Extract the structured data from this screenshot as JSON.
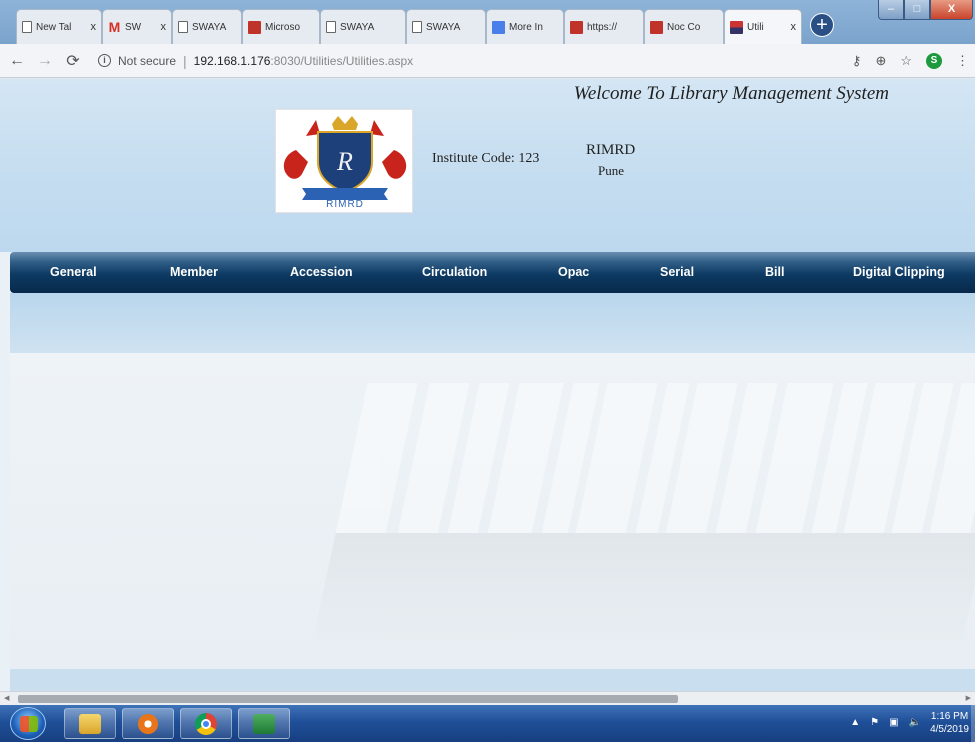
{
  "browser": {
    "tabs": [
      {
        "title": "New Tal",
        "favicon": "page-icon",
        "closable": true
      },
      {
        "title": "SW",
        "favicon": "gmail-icon",
        "closable": true
      },
      {
        "title": "SWAYA",
        "favicon": "document-icon",
        "closable": false
      },
      {
        "title": "Microso",
        "favicon": "app-red-icon",
        "closable": false
      },
      {
        "title": "SWAYA",
        "favicon": "document-icon",
        "closable": false
      },
      {
        "title": "SWAYA",
        "favicon": "document-icon",
        "closable": false
      },
      {
        "title": "More In",
        "favicon": "forms-icon",
        "closable": false
      },
      {
        "title": "https://",
        "favicon": "app-red-icon",
        "closable": false
      },
      {
        "title": "Noc Co",
        "favicon": "app-red-icon",
        "closable": false
      },
      {
        "title": "Utili",
        "favicon": "flag-icon",
        "closable": true
      }
    ],
    "new_tab_label": "+",
    "close_glyph": "x",
    "window_controls": {
      "minimize": "–",
      "maximize": "□",
      "close": "X"
    },
    "address": {
      "security_label": "Not secure",
      "url_host": "192.168.1.176",
      "url_path": ":8030/Utilities/Utilities.aspx"
    },
    "profile_initial": "S"
  },
  "header": {
    "welcome": "Welcome To Library Management System",
    "logo_caption": "RIMRD",
    "logo_monogram": "R",
    "institute_code_label": "Institute Code: 123",
    "institute_name": "RIMRD",
    "institute_city": "Pune"
  },
  "menu": [
    {
      "label": "General"
    },
    {
      "label": "Member"
    },
    {
      "label": "Accession"
    },
    {
      "label": "Circulation"
    },
    {
      "label": "Opac"
    },
    {
      "label": "Serial"
    },
    {
      "label": "Bill"
    },
    {
      "label": "Digital Clipping"
    }
  ],
  "taskbar": {
    "apps": [
      "folder-icon",
      "media-player-icon",
      "chrome-icon",
      "excel-icon"
    ],
    "clock_time": "1:16 PM",
    "clock_date": "4/5/2019"
  },
  "colors": {
    "menu_bar": "#0d3a63",
    "header_bg": "#c5ddf0",
    "taskbar": "#1f4f98"
  }
}
